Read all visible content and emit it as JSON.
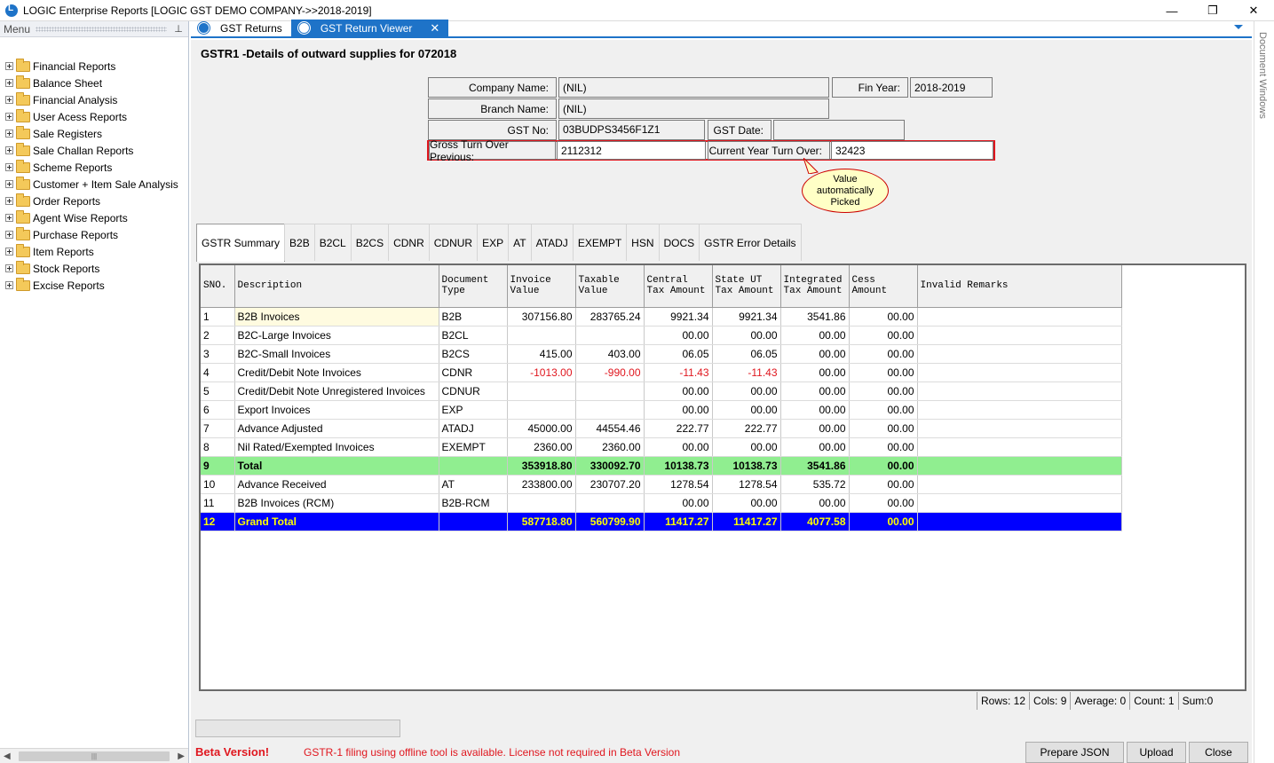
{
  "window": {
    "title": "LOGIC Enterprise Reports  [LOGIC GST DEMO COMPANY->>2018-2019]",
    "minimize": "—",
    "restore": "❐",
    "close": "✕"
  },
  "menu": {
    "header": "Menu",
    "pin": "⊥",
    "items": [
      {
        "label": "Financial Reports"
      },
      {
        "label": "Balance Sheet"
      },
      {
        "label": "Financial Analysis"
      },
      {
        "label": "User Acess Reports"
      },
      {
        "label": "Sale Registers"
      },
      {
        "label": "Sale Challan Reports"
      },
      {
        "label": "Scheme Reports"
      },
      {
        "label": "Customer + Item Sale Analysis"
      },
      {
        "label": "Order Reports"
      },
      {
        "label": "Agent Wise Reports"
      },
      {
        "label": "Purchase Reports"
      },
      {
        "label": "Item Reports"
      },
      {
        "label": "Stock Reports"
      },
      {
        "label": "Excise Reports"
      }
    ],
    "scroll_left": "◀",
    "scroll_right": "▶",
    "scroll_grip": "|||"
  },
  "doc_tabs": [
    {
      "label": "GST Returns"
    },
    {
      "label": "GST Return Viewer",
      "close": "✕"
    }
  ],
  "side_panel": {
    "label": "Document Windows"
  },
  "page": {
    "title": "GSTR1 -Details of outward supplies for 072018"
  },
  "form": {
    "company_label": "Company Name:",
    "company_value": "(NIL)",
    "fin_year_label": "Fin Year:",
    "fin_year_value": "2018-2019",
    "branch_label": "Branch Name:",
    "branch_value": "(NIL)",
    "gst_no_label": "GST No:",
    "gst_no_value": "03BUDPS3456F1Z1",
    "gst_date_label": "GST Date:",
    "gst_date_value": "",
    "gross_label": "Gross Turn Over Previous:",
    "gross_value": "2112312",
    "current_label": "Current Year Turn Over:",
    "current_value": "32423"
  },
  "callout": {
    "line1": "Value",
    "line2": "automatically",
    "line3": "Picked"
  },
  "tabs": [
    {
      "label": "GSTR Summary"
    },
    {
      "label": "B2B"
    },
    {
      "label": "B2CL"
    },
    {
      "label": "B2CS"
    },
    {
      "label": "CDNR"
    },
    {
      "label": "CDNUR"
    },
    {
      "label": "EXP"
    },
    {
      "label": "AT"
    },
    {
      "label": "ATADJ"
    },
    {
      "label": "EXEMPT"
    },
    {
      "label": "HSN"
    },
    {
      "label": "DOCS"
    },
    {
      "label": "GSTR Error Details"
    }
  ],
  "grid": {
    "headers": {
      "sno": "SNO.",
      "desc": "Description",
      "doc1": "Document",
      "doc2": "Type",
      "inv1": "Invoice",
      "inv2": "Value",
      "tax1": "Taxable",
      "tax2": "Value",
      "cen1": "Central",
      "cen2": "Tax Amount",
      "sut1": "State UT",
      "sut2": "Tax Amount",
      "int1": "Integrated",
      "int2": "Tax Amount",
      "cess1": "Cess",
      "cess2": "Amount",
      "rem": "Invalid Remarks"
    },
    "rows": [
      {
        "sno": "1",
        "desc": "B2B Invoices",
        "type": "B2B",
        "inv": "307156.80",
        "taxable": "283765.24",
        "central": "9921.34",
        "state": "9921.34",
        "integrated": "3541.86",
        "cess": "00.00"
      },
      {
        "sno": "2",
        "desc": "B2C-Large Invoices",
        "type": "B2CL",
        "inv": "",
        "taxable": "",
        "central": "00.00",
        "state": "00.00",
        "integrated": "00.00",
        "cess": "00.00"
      },
      {
        "sno": "3",
        "desc": "B2C-Small Invoices",
        "type": "B2CS",
        "inv": "415.00",
        "taxable": "403.00",
        "central": "06.05",
        "state": "06.05",
        "integrated": "00.00",
        "cess": "00.00"
      },
      {
        "sno": "4",
        "desc": "Credit/Debit Note Invoices",
        "type": "CDNR",
        "inv": "-1013.00",
        "taxable": "-990.00",
        "central": "-11.43",
        "state": "-11.43",
        "integrated": "00.00",
        "cess": "00.00"
      },
      {
        "sno": "5",
        "desc": "Credit/Debit Note Unregistered Invoices",
        "type": "CDNUR",
        "inv": "",
        "taxable": "",
        "central": "00.00",
        "state": "00.00",
        "integrated": "00.00",
        "cess": "00.00"
      },
      {
        "sno": "6",
        "desc": "Export Invoices",
        "type": "EXP",
        "inv": "",
        "taxable": "",
        "central": "00.00",
        "state": "00.00",
        "integrated": "00.00",
        "cess": "00.00"
      },
      {
        "sno": "7",
        "desc": "Advance Adjusted",
        "type": "ATADJ",
        "inv": "45000.00",
        "taxable": "44554.46",
        "central": "222.77",
        "state": "222.77",
        "integrated": "00.00",
        "cess": "00.00"
      },
      {
        "sno": "8",
        "desc": "Nil Rated/Exempted  Invoices",
        "type": "EXEMPT",
        "inv": "2360.00",
        "taxable": "2360.00",
        "central": "00.00",
        "state": "00.00",
        "integrated": "00.00",
        "cess": "00.00"
      },
      {
        "sno": "9",
        "desc": "Total",
        "type": "",
        "inv": "353918.80",
        "taxable": "330092.70",
        "central": "10138.73",
        "state": "10138.73",
        "integrated": "3541.86",
        "cess": "00.00"
      },
      {
        "sno": "10",
        "desc": "Advance Received",
        "type": "AT",
        "inv": "233800.00",
        "taxable": "230707.20",
        "central": "1278.54",
        "state": "1278.54",
        "integrated": "535.72",
        "cess": "00.00"
      },
      {
        "sno": "11",
        "desc": "B2B Invoices (RCM)",
        "type": "B2B-RCM",
        "inv": "",
        "taxable": "",
        "central": "00.00",
        "state": "00.00",
        "integrated": "00.00",
        "cess": "00.00"
      },
      {
        "sno": "12",
        "desc": "Grand Total",
        "type": "",
        "inv": "587718.80",
        "taxable": "560799.90",
        "central": "11417.27",
        "state": "11417.27",
        "integrated": "4077.58",
        "cess": "00.00"
      }
    ]
  },
  "status": {
    "rows": "Rows: 12",
    "cols": "Cols: 9",
    "average": "Average: 0",
    "count": "Count: 1",
    "sum": "Sum:0"
  },
  "footer": {
    "beta": "Beta Version!",
    "message": "GSTR-1 filing using offline tool is available. License not required in Beta Version",
    "prepare_json": "Prepare JSON",
    "upload": "Upload",
    "close": "Close"
  },
  "colors": {
    "accent": "#1e73c8",
    "total_row": "#90ee90",
    "grand_total_row": "#0000ff",
    "grand_total_text": "#ffff00",
    "negative": "#e0171f"
  }
}
